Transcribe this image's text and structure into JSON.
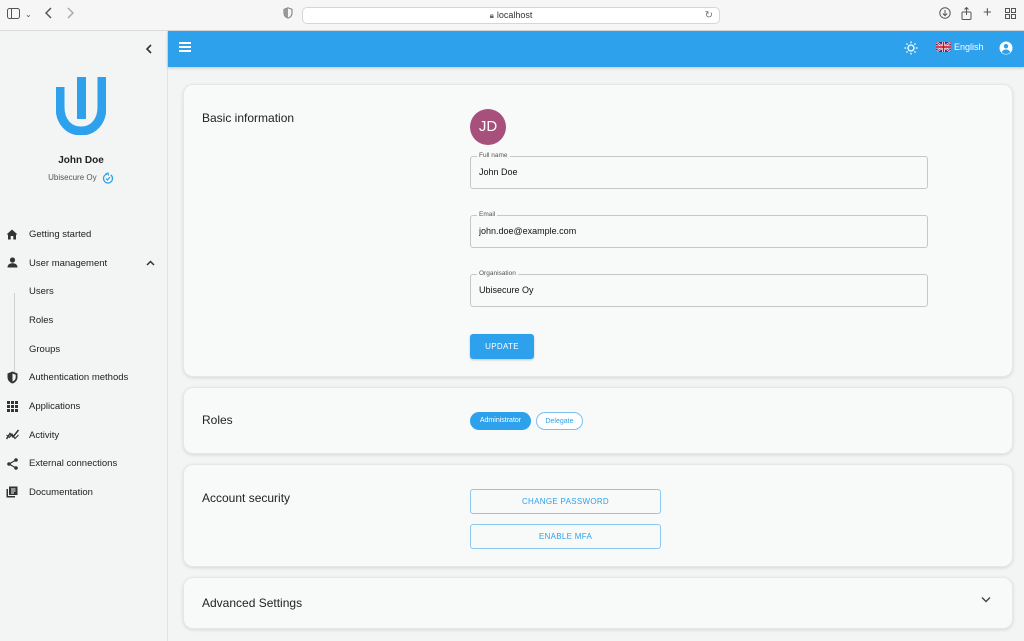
{
  "browser": {
    "url": "localhost"
  },
  "sidebar": {
    "user_name": "John Doe",
    "organisation": "Ubisecure Oy",
    "nav": [
      {
        "label": "Getting started",
        "icon": "home-icon"
      },
      {
        "label": "User management",
        "icon": "person-icon",
        "expanded": true
      },
      {
        "label": "Users"
      },
      {
        "label": "Roles"
      },
      {
        "label": "Groups"
      },
      {
        "label": "Authentication methods",
        "icon": "shield-icon"
      },
      {
        "label": "Applications",
        "icon": "apps-grid-icon"
      },
      {
        "label": "Activity",
        "icon": "activity-chart-icon"
      },
      {
        "label": "External connections",
        "icon": "share-icon"
      },
      {
        "label": "Documentation",
        "icon": "library-books-icon"
      }
    ]
  },
  "header": {
    "language": "English"
  },
  "basic_info": {
    "title": "Basic information",
    "avatar_initials": "JD",
    "full_name_label": "Full name",
    "full_name": "John Doe",
    "email_label": "Email",
    "email": "john.doe@example.com",
    "organisation_label": "Organisation",
    "organisation": "Ubisecure Oy",
    "update_label": "UPDATE"
  },
  "roles": {
    "title": "Roles",
    "chips": [
      "Administrator",
      "Delegate"
    ]
  },
  "account_security": {
    "title": "Account security",
    "change_password_label": "CHANGE PASSWORD",
    "enable_mfa_label": "ENABLE MFA"
  },
  "advanced": {
    "title": "Advanced Settings"
  },
  "colors": {
    "accent": "#2ea1ec",
    "avatar": "#a7507b"
  }
}
